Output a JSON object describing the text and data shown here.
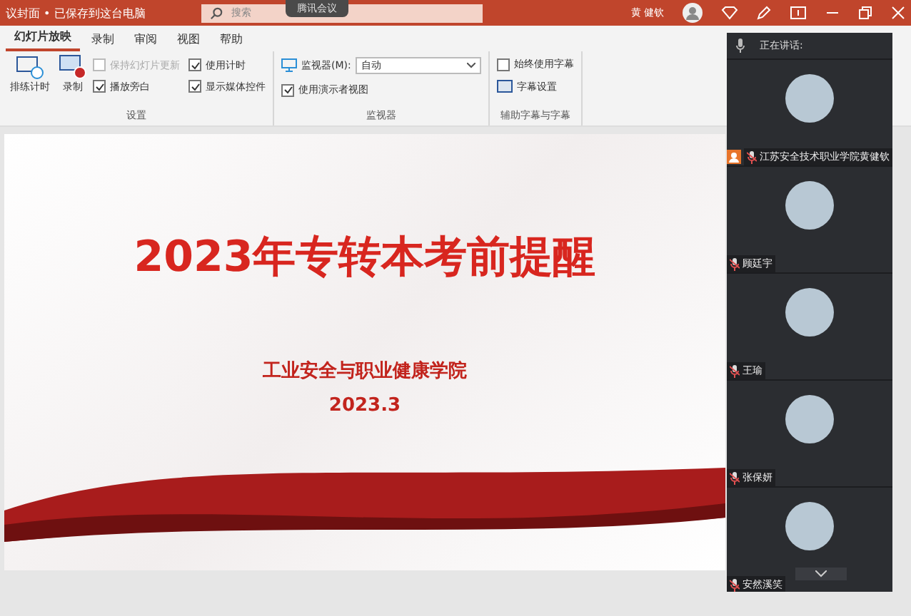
{
  "titlebar": {
    "doc_title": "议封面 • 已保存到这台电脑",
    "search": {
      "placeholder": "搜索"
    },
    "meeting_pill": "腾讯会议",
    "user": "黄 健钦"
  },
  "tabs": [
    {
      "label": "幻灯片放映",
      "selected": true
    },
    {
      "label": "录制",
      "selected": false
    },
    {
      "label": "审阅",
      "selected": false
    },
    {
      "label": "视图",
      "selected": false
    },
    {
      "label": "帮助",
      "selected": false
    }
  ],
  "ribbon": {
    "settings": {
      "big_buttons": [
        "排练计时",
        "录制"
      ],
      "checkboxes": [
        {
          "label": "保持幻灯片更新",
          "checked": false,
          "disabled": true
        },
        {
          "label": "使用计时",
          "checked": true,
          "disabled": false
        },
        {
          "label": "播放旁白",
          "checked": true,
          "disabled": false
        },
        {
          "label": "显示媒体控件",
          "checked": true,
          "disabled": false
        }
      ],
      "group_label": "设置"
    },
    "monitor": {
      "label": "监视器(M):",
      "value": "自动",
      "presenter_view": {
        "label": "使用演示者视图",
        "checked": true
      },
      "group_label": "监视器"
    },
    "captions": {
      "always": {
        "label": "始终使用字幕",
        "checked": false
      },
      "settings": "字幕设置",
      "group_label": "辅助字幕与字幕"
    }
  },
  "slide": {
    "title": "2023年专转本考前提醒",
    "subtitle": "工业安全与职业健康学院",
    "date": "2023.3"
  },
  "meeting": {
    "speaking_label": "正在讲话:",
    "participants": [
      {
        "name": "江苏安全技术职业学院黄健钦",
        "host": true
      },
      {
        "name": "顾廷宇",
        "host": false
      },
      {
        "name": "王瑜",
        "host": false
      },
      {
        "name": "张保妍",
        "host": false
      },
      {
        "name": "安然溪笑",
        "host": false
      }
    ]
  }
}
